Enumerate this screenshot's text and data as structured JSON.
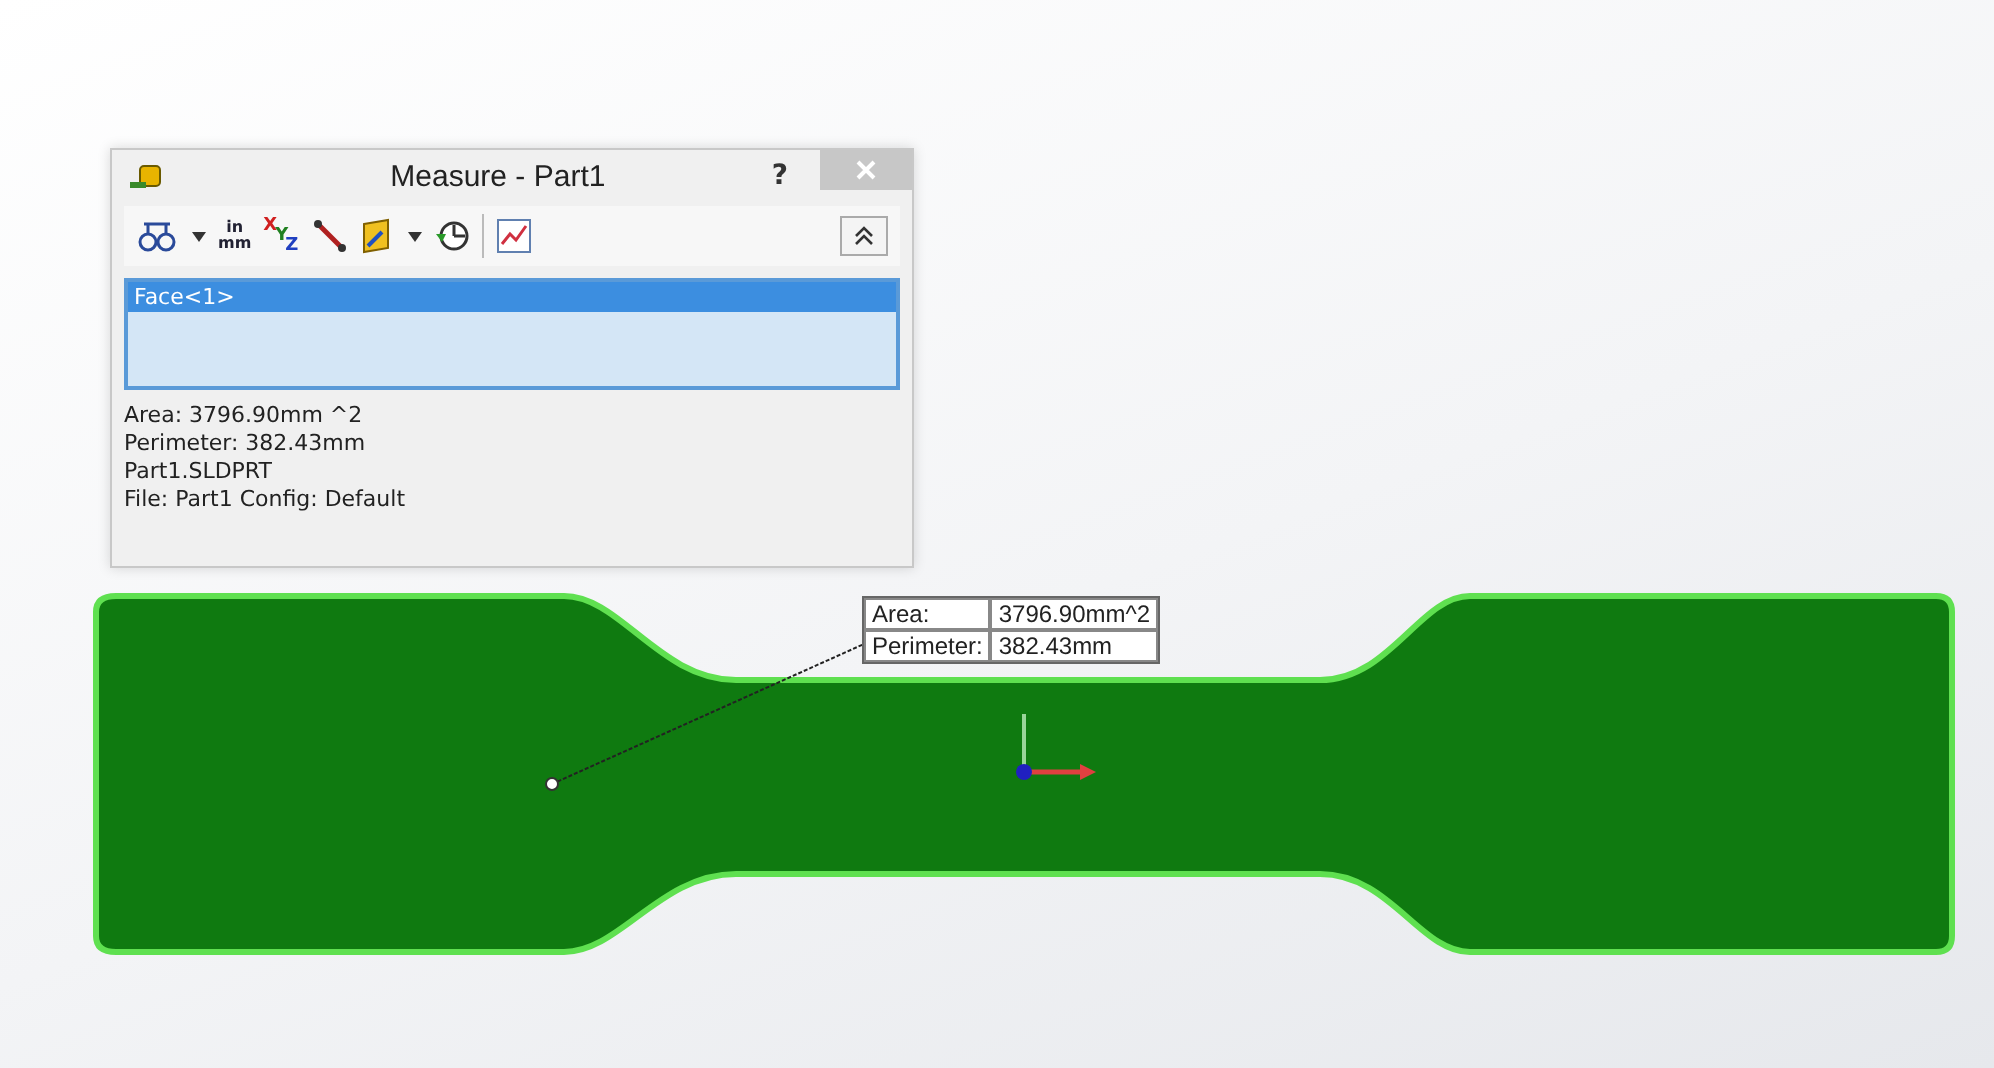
{
  "dialog": {
    "title": "Measure - Part1",
    "help": "?",
    "units": {
      "top": "in",
      "bottom": "mm"
    },
    "axes": [
      "X",
      "Y",
      "Z"
    ],
    "selections": [
      {
        "label": "Face<1>",
        "selected": true
      }
    ],
    "results": [
      "Area: 3796.90mm ^2",
      "Perimeter: 382.43mm",
      "Part1.SLDPRT",
      "File: Part1 Config: Default"
    ]
  },
  "callout": [
    {
      "label": "Area:",
      "value": "3796.90mm^2"
    },
    {
      "label": "Perimeter:",
      "value": "382.43mm"
    }
  ]
}
